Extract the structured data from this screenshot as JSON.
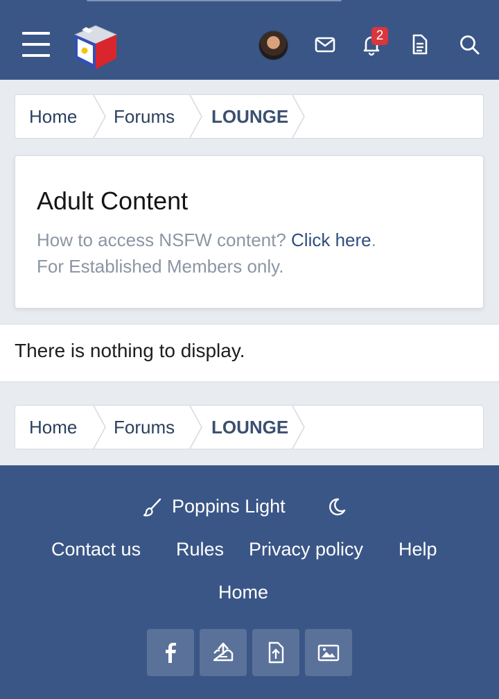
{
  "header": {
    "notification_count": "2",
    "icons": [
      "menu-icon",
      "site-logo",
      "avatar",
      "mail-icon",
      "bell-icon",
      "document-icon",
      "search-icon"
    ]
  },
  "breadcrumb": {
    "items": [
      "Home",
      "Forums",
      "LOUNGE"
    ]
  },
  "notice": {
    "title": "Adult Content",
    "line1_text": "How to access NSFW content? ",
    "line1_link": "Click here",
    "line1_end": ".",
    "line2": "For Established Members only."
  },
  "main": {
    "empty_message": "There is nothing to display."
  },
  "footer": {
    "style_name": "Poppins Light",
    "links": [
      "Contact us",
      "Rules",
      "Privacy policy",
      "Help"
    ],
    "home_link": "Home",
    "share_icons": [
      "facebook-icon",
      "upload-icon",
      "file-upload-icon",
      "image-icon"
    ]
  },
  "colors": {
    "header_bg": "#3a5686",
    "page_bg": "#e8ebf0",
    "badge": "#d9363e",
    "link": "#2f4d7f"
  }
}
